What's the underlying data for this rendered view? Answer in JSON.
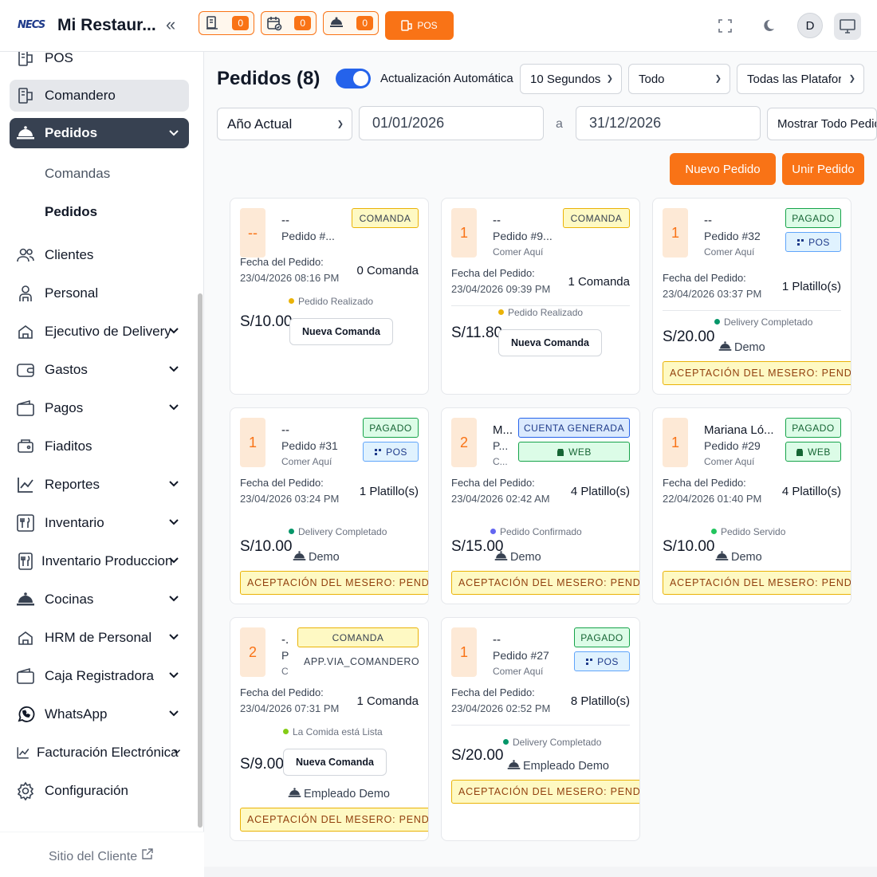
{
  "header": {
    "logo_text": "NECS",
    "title": "Mi Restaur...",
    "counters": [
      "0",
      "0",
      "0"
    ],
    "pos_label": "POS",
    "avatar_letter": "D"
  },
  "sidebar": {
    "items": [
      {
        "label": "POS"
      },
      {
        "label": "Comandero"
      },
      {
        "label": "Pedidos"
      },
      {
        "label": "Clientes"
      },
      {
        "label": "Personal"
      },
      {
        "label": "Ejecutivo de Delivery"
      },
      {
        "label": "Gastos"
      },
      {
        "label": "Pagos"
      },
      {
        "label": "Fiaditos"
      },
      {
        "label": "Reportes"
      },
      {
        "label": "Inventario"
      },
      {
        "label": "Inventario Produccion"
      },
      {
        "label": "Cocinas"
      },
      {
        "label": "HRM de Personal"
      },
      {
        "label": "Caja Registradora"
      },
      {
        "label": "WhatsApp"
      },
      {
        "label": "Facturación Electrónica"
      },
      {
        "label": "Configuración"
      }
    ],
    "subitems": [
      "Comandas",
      "Pedidos"
    ],
    "footer_link": "Sitio del Cliente"
  },
  "main": {
    "title": "Pedidos (8)",
    "auto_update_label": "Actualización Automática",
    "interval_select": "10 Segundos",
    "type_select": "Todo",
    "platform_select": "Todas las Plataformas",
    "period_select": "Año Actual",
    "date_from": "01/01/2026",
    "date_sep": "a",
    "date_to": "31/12/2026",
    "show_select": "Mostrar Todo Pedidos",
    "new_order_button": "Nuevo Pedido",
    "merge_order_button": "Unir Pedido",
    "date_label": "Fecha del Pedido:",
    "new_comanda_label": "Nueva Comanda",
    "waiter_label": "ACEPTACIÓN DEL MESERO: PENDIENTE"
  },
  "colors": {
    "accent": "#f97316",
    "sidebar_active": "#374151",
    "toggle": "#2563eb"
  },
  "orders": [
    {
      "num": "--",
      "name": "--",
      "order": "Pedido #...",
      "type": "",
      "badge": "COMANDA",
      "platform": "",
      "date": "23/04/2026 08:16 PM",
      "qty": "0 Comanda",
      "status": "Pedido Realizado",
      "price": "S/10.00",
      "employee": ""
    },
    {
      "num": "1",
      "name": "--",
      "order": "Pedido #9...",
      "type": "Comer Aquí",
      "badge": "COMANDA",
      "platform": "",
      "date": "23/04/2026 09:39 PM",
      "qty": "1 Comanda",
      "status": "Pedido Realizado",
      "price": "S/11.80",
      "employee": ""
    },
    {
      "num": "1",
      "name": "--",
      "order": "Pedido #32",
      "type": "Comer Aquí",
      "badge": "PAGADO",
      "platform": "POS",
      "date": "23/04/2026 03:37 PM",
      "qty": "1 Platillo(s)",
      "status": "Delivery Completado",
      "price": "S/20.00",
      "employee": "Demo"
    },
    {
      "num": "1",
      "name": "--",
      "order": "Pedido #31",
      "type": "Comer Aquí",
      "badge": "PAGADO",
      "platform": "POS",
      "date": "23/04/2026 03:24 PM",
      "qty": "1 Platillo(s)",
      "status": "Delivery Completado",
      "price": "S/10.00",
      "employee": "Demo"
    },
    {
      "num": "2",
      "name": "M...",
      "order": "P...",
      "type": "C...",
      "badge": "CUENTA GENERADA",
      "platform": "WEB",
      "date": "23/04/2026 02:42 AM",
      "qty": "4 Platillo(s)",
      "status": "Pedido Confirmado",
      "price": "S/15.00",
      "employee": "Demo"
    },
    {
      "num": "1",
      "name": "Mariana Ló...",
      "order": "Pedido #29",
      "type": "Comer Aquí",
      "badge": "PAGADO",
      "platform": "WEB",
      "date": "22/04/2026 01:40 PM",
      "qty": "4 Platillo(s)",
      "status": "Pedido Servido",
      "price": "S/10.00",
      "employee": "Demo"
    },
    {
      "num": "2",
      "name": "-.",
      "order": "P",
      "type": "C",
      "badge": "COMANDA",
      "platform": "APP.VIA_COMANDERO",
      "date": "23/04/2026 07:31 PM",
      "qty": "1 Comanda",
      "status": "La Comida está Lista",
      "price": "S/9.00",
      "employee": "Empleado Demo"
    },
    {
      "num": "1",
      "name": "--",
      "order": "Pedido #27",
      "type": "Comer Aquí",
      "badge": "PAGADO",
      "platform": "POS",
      "date": "23/04/2026 02:52 PM",
      "qty": "8 Platillo(s)",
      "status": "Delivery Completado",
      "price": "S/20.00",
      "employee": "Empleado Demo"
    }
  ]
}
